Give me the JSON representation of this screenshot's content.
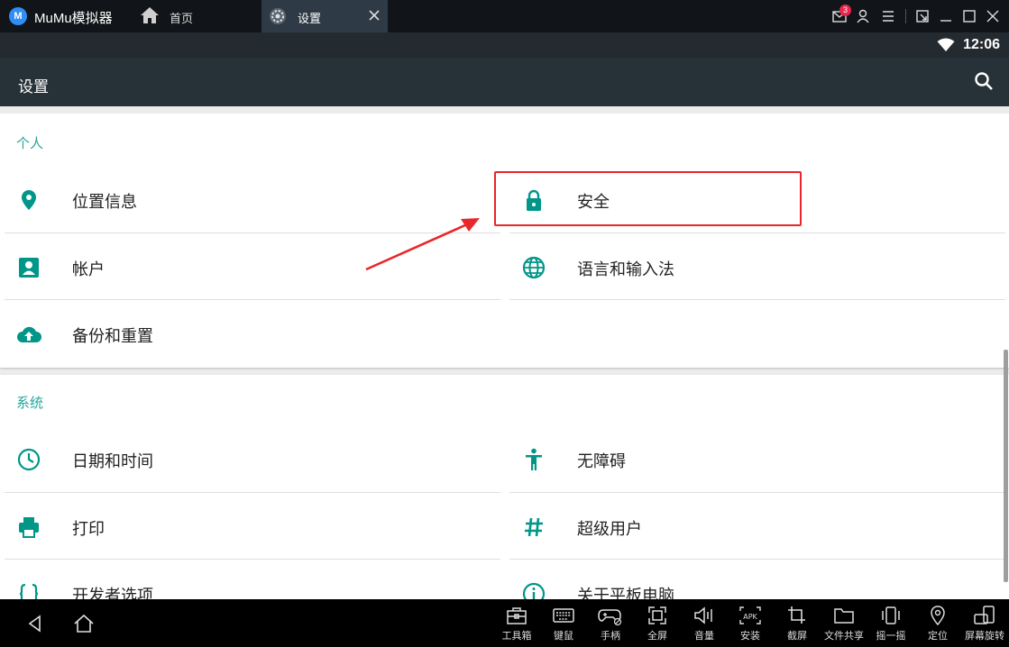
{
  "window": {
    "app_name": "MuMu模拟器",
    "logo_text": "M",
    "home_tab_label": "首页",
    "active_tab_label": "设置",
    "notification_count": "3"
  },
  "status_bar": {
    "time": "12:06"
  },
  "action_bar": {
    "title": "设置"
  },
  "sections": [
    {
      "title": "个人",
      "items": [
        {
          "label": "位置信息",
          "icon": "location-pin-icon"
        },
        {
          "label": "安全",
          "icon": "lock-icon"
        },
        {
          "label": "帐户",
          "icon": "account-box-icon"
        },
        {
          "label": "语言和输入法",
          "icon": "globe-icon"
        },
        {
          "label": "备份和重置",
          "icon": "cloud-upload-icon"
        }
      ]
    },
    {
      "title": "系统",
      "items": [
        {
          "label": "日期和时间",
          "icon": "clock-icon"
        },
        {
          "label": "无障碍",
          "icon": "accessibility-icon"
        },
        {
          "label": "打印",
          "icon": "printer-icon"
        },
        {
          "label": "超级用户",
          "icon": "hash-icon"
        },
        {
          "label": "开发者选项",
          "icon": "braces-icon"
        },
        {
          "label": "关于平板电脑",
          "icon": "info-icon"
        }
      ]
    }
  ],
  "toolbar": [
    {
      "label": "工具箱",
      "icon": "toolbox-icon"
    },
    {
      "label": "键鼠",
      "icon": "keyboard-icon"
    },
    {
      "label": "手柄",
      "icon": "gamepad-icon"
    },
    {
      "label": "全屏",
      "icon": "fullscreen-icon"
    },
    {
      "label": "音量",
      "icon": "volume-icon"
    },
    {
      "label": "安装",
      "icon": "apk-install-icon"
    },
    {
      "label": "截屏",
      "icon": "crop-icon"
    },
    {
      "label": "文件共享",
      "icon": "folder-icon"
    },
    {
      "label": "摇一摇",
      "icon": "shake-icon"
    },
    {
      "label": "定位",
      "icon": "location-icon"
    },
    {
      "label": "屏幕旋转",
      "icon": "rotate-screen-icon"
    }
  ],
  "colors": {
    "accent": "#009688",
    "section_title": "#26a69a",
    "action_bar": "#263238",
    "highlight": "#e8262b"
  }
}
